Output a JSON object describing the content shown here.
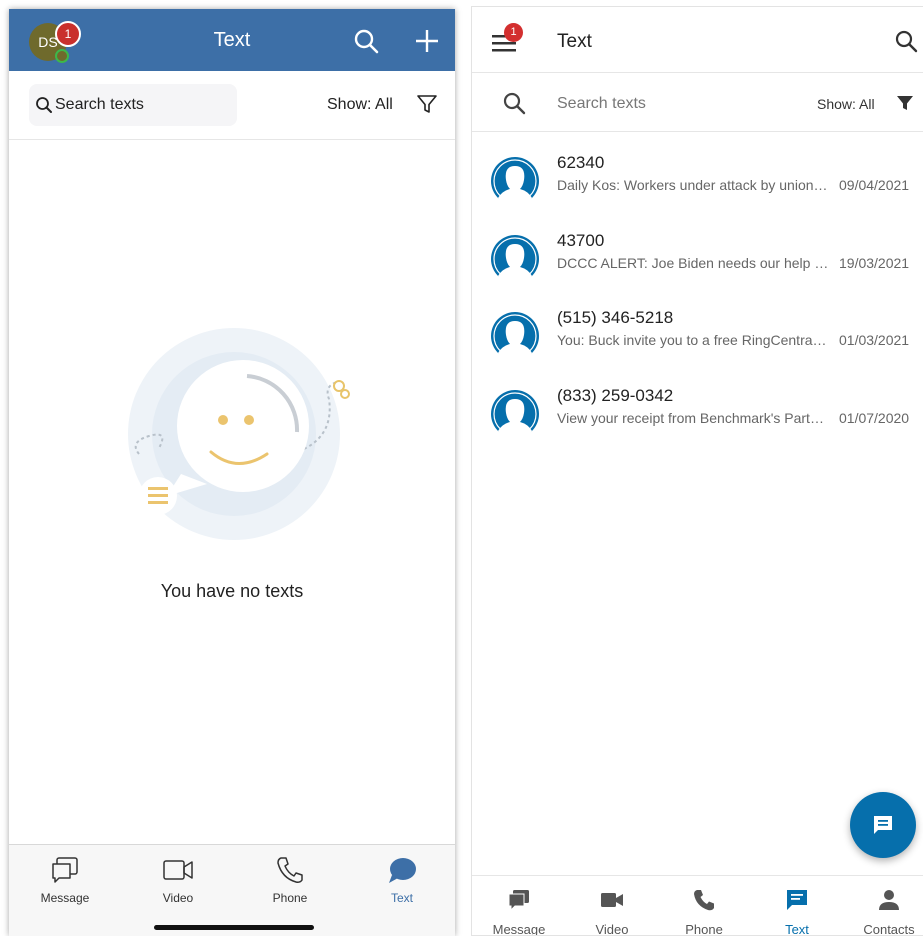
{
  "left": {
    "header": {
      "title": "Text",
      "avatar_initials": "DS",
      "badge_count": "1"
    },
    "search": {
      "placeholder": "Search texts"
    },
    "filter": {
      "show_label": "Show: All"
    },
    "empty_message": "You have no texts",
    "tabs": [
      {
        "label": "Message",
        "icon": "message-icon",
        "active": false
      },
      {
        "label": "Video",
        "icon": "video-icon",
        "active": false
      },
      {
        "label": "Phone",
        "icon": "phone-icon",
        "active": false
      },
      {
        "label": "Text",
        "icon": "text-icon",
        "active": true
      }
    ],
    "colors": {
      "header": "#3d6fa7",
      "badge": "#c9302c",
      "presence": "#3db84a"
    }
  },
  "right": {
    "appbar": {
      "title": "Text",
      "badge_count": "1"
    },
    "search": {
      "placeholder": "Search texts"
    },
    "filter": {
      "show_label": "Show: All"
    },
    "conversations": [
      {
        "name": "62340",
        "preview": "Daily Kos: Workers under attack by union-busting law firm",
        "date": "09/04/2021"
      },
      {
        "name": "43700",
        "preview": "DCCC ALERT: Joe Biden needs our help today",
        "date": "19/03/2021"
      },
      {
        "name": "(515) 346-5218",
        "preview": "You: Buck invite you to a free RingCentral account",
        "date": "01/03/2021"
      },
      {
        "name": "(833) 259-0342",
        "preview": "View your receipt from Benchmark's Parts Store",
        "date": "01/07/2020"
      }
    ],
    "nav": [
      {
        "label": "Message",
        "icon": "message-icon",
        "active": false
      },
      {
        "label": "Video",
        "icon": "video-icon",
        "active": false
      },
      {
        "label": "Phone",
        "icon": "phone-icon",
        "active": false
      },
      {
        "label": "Text",
        "icon": "text-icon",
        "active": true
      },
      {
        "label": "Contacts",
        "icon": "contacts-icon",
        "active": false
      }
    ],
    "colors": {
      "accent": "#066fac",
      "badge": "#d32f2f"
    }
  }
}
